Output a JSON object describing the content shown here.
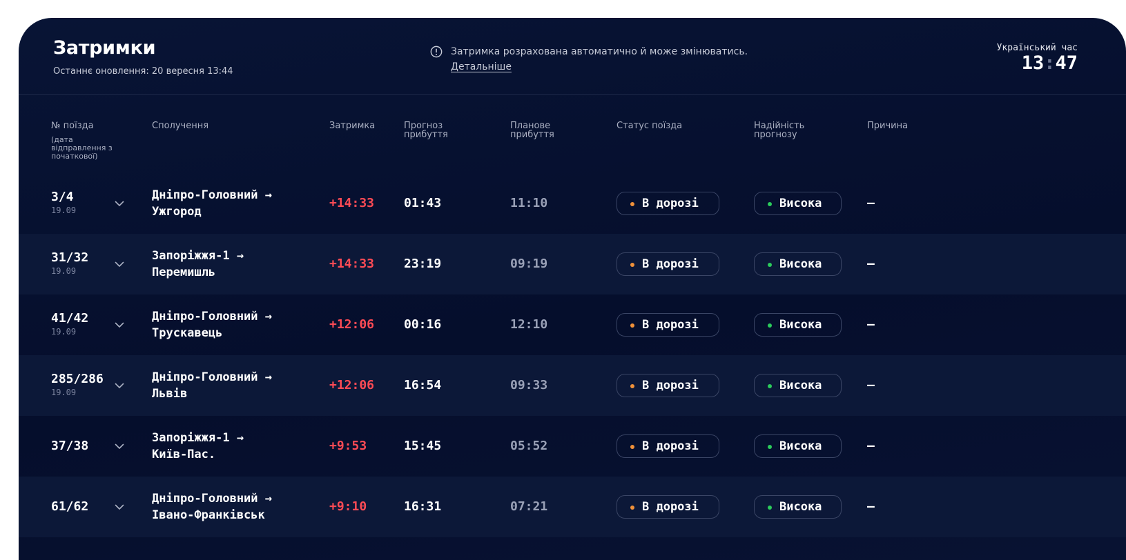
{
  "header": {
    "title": "Затримки",
    "updated": "Останнє оновлення: 20 вересня 13:44",
    "notice": "Затримка розрахована автоматично й може змінюватись.",
    "notice_link": "Детальніше",
    "clock_label": "Український час",
    "clock_hours": "13",
    "clock_sep": ":",
    "clock_minutes": "47"
  },
  "columns": {
    "train": "№ поїзда",
    "train_sub": "(дата відправлення з початкової)",
    "route": "Сполучення",
    "delay": "Затримка",
    "forecast": "Прогноз прибуття",
    "planned": "Планове прибуття",
    "status": "Статус поїзда",
    "reliability": "Надійність прогнозу",
    "reason": "Причина"
  },
  "colors": {
    "status_dot": "#f0913a",
    "reliability_dot": "#2bcb5b",
    "delay": "#ff4b55"
  },
  "icons": {
    "notice": "info-circle-icon",
    "expand": "chevron-down-icon"
  },
  "rows": [
    {
      "train": "3/4",
      "date": "19.09",
      "from": "Дніпро-Головний →",
      "to": "Ужгород",
      "delay": "+14:33",
      "forecast": "01:43",
      "planned": "11:10",
      "status": "В дорозі",
      "reliability": "Висока",
      "reason": "—"
    },
    {
      "train": "31/32",
      "date": "19.09",
      "from": "Запоріжжя-1 →",
      "to": "Перемишль",
      "delay": "+14:33",
      "forecast": "23:19",
      "planned": "09:19",
      "status": "В дорозі",
      "reliability": "Висока",
      "reason": "—"
    },
    {
      "train": "41/42",
      "date": "19.09",
      "from": "Дніпро-Головний →",
      "to": "Трускавець",
      "delay": "+12:06",
      "forecast": "00:16",
      "planned": "12:10",
      "status": "В дорозі",
      "reliability": "Висока",
      "reason": "—"
    },
    {
      "train": "285/286",
      "date": "19.09",
      "from": "Дніпро-Головний →",
      "to": "Львів",
      "delay": "+12:06",
      "forecast": "16:54",
      "planned": "09:33",
      "status": "В дорозі",
      "reliability": "Висока",
      "reason": "—"
    },
    {
      "train": "37/38",
      "date": "",
      "from": "Запоріжжя-1 →",
      "to": "Київ-Пас.",
      "delay": "+9:53",
      "forecast": "15:45",
      "planned": "05:52",
      "status": "В дорозі",
      "reliability": "Висока",
      "reason": "—"
    },
    {
      "train": "61/62",
      "date": "",
      "from": "Дніпро-Головний →",
      "to": "Івано-Франківськ",
      "delay": "+9:10",
      "forecast": "16:31",
      "planned": "07:21",
      "status": "В дорозі",
      "reliability": "Висока",
      "reason": "—"
    }
  ]
}
